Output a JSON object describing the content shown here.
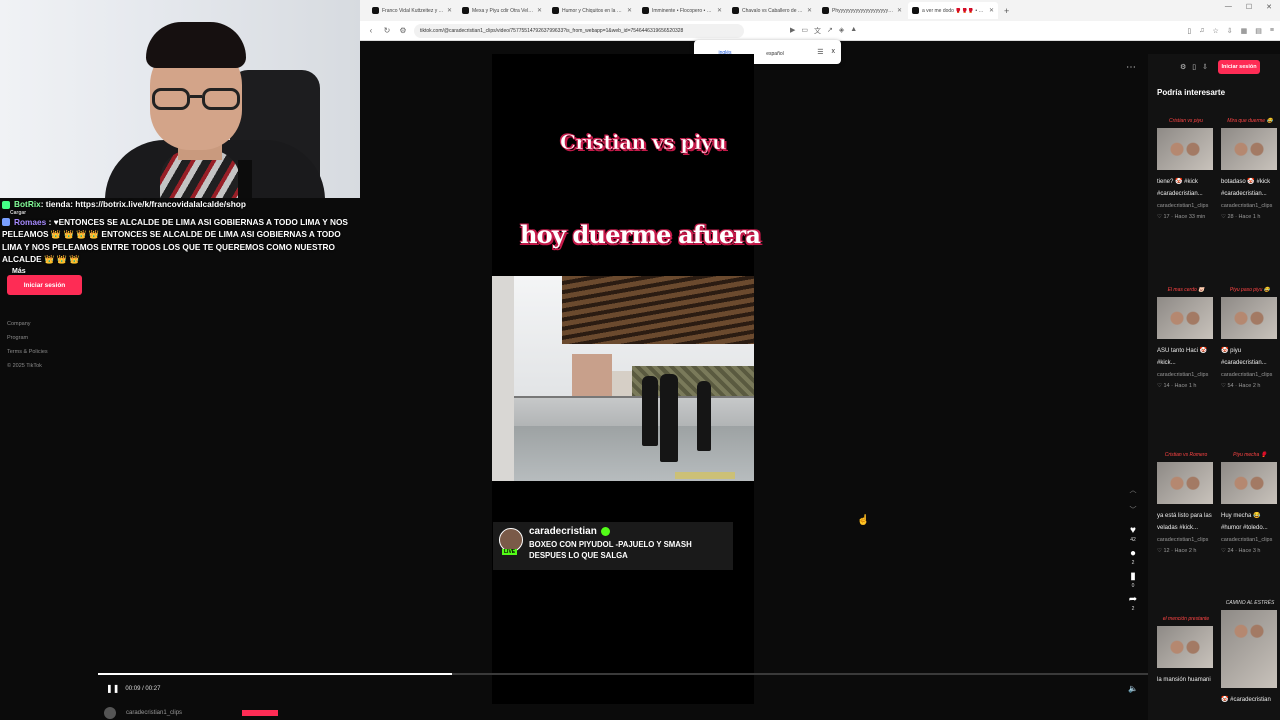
{
  "browser": {
    "tabs": [
      {
        "title": "Franco Vidal Kuttzeitez y Alcalde en..."
      },
      {
        "title": "Mexa y Piyu cdir Otra Velada Fracaso"
      },
      {
        "title": "Humor y Chiquitos en la Velada de..."
      },
      {
        "title": "Imminente • Flocopero • Plocanig"
      },
      {
        "title": "Chavalo vs Caballero de Aldeiro La Ci..."
      },
      {
        "title": "Phyyyyyyyyyyyyyyyyyyyyyyyyyyy..."
      },
      {
        "title": "a ver me dodo 🥊🥊🥊 • TikTok"
      }
    ],
    "url": "tiktok.com/@caradecristian1_clips/video/7577551479263799633?is_from_webapp=1&web_id=7546446319656520328",
    "translate": {
      "lang1": "inglés",
      "lang2": "español",
      "close": "x"
    }
  },
  "chat": [
    {
      "name": "BotRix",
      "text": ": tienda: https://botrix.live/k/francovidalalcalde/shop"
    },
    {
      "name": "Romaes",
      "text": ": ♥ENTONCES SE ALCALDE DE LIMA ASI GOBIERNAS A TODO LIMA Y NOS PELEAMOS 👑 👑 👑 👑 ENTONCES SE ALCALDE DE LIMA ASI GOBIERNAS A TODO LIMA Y NOS PELEAMOS ENTRE TODOS LOS QUE TE QUEREMOS COMO NUESTRO ALCALDE 👑 👑 👑"
    },
    {
      "more": "Más",
      "extra": "Cargar"
    }
  ],
  "left": {
    "login": "Iniciar sesión",
    "links": [
      "Company",
      "Program",
      "Terms & Policies",
      "© 2025 TikTok"
    ]
  },
  "video": {
    "title_top": "Cristian vs piyu",
    "title_main": "hoy duerme afuera",
    "streamer": "caradecristian",
    "live": "LIVE",
    "desc_line1": "BOXEO CON PIYUDOL -PAJUELO Y SMASH",
    "desc_line2": "DESPUES LO QUE SALGA",
    "time": "00:09 / 00:27",
    "progress": 0.337,
    "counts": {
      "likes": "42",
      "comments": "2",
      "saves": "0",
      "shares": "2"
    },
    "bottom_author": "caradecristian1_clips"
  },
  "right": {
    "login": "Iniciar sesión",
    "heading": "Podría interesarte",
    "items": [
      {
        "cap": "Cristian vs piyu",
        "title": "tiene? 🤡 #kick #caradecristian...",
        "author": "caradecristian1_clips",
        "meta": "♡ 17 · Hace 33 min"
      },
      {
        "cap": "Mira que duerme 😂",
        "title": "botadaso 🤡 #kick #caradecristian...",
        "author": "caradecristian1_clips",
        "meta": "♡ 28 · Hace 1 h"
      },
      {
        "cap": "El mas cerdo 🐷",
        "title": "ASU tanto Haci 🤡 #kick...",
        "author": "caradecristian1_clips",
        "meta": "♡ 14 · Hace 1 h"
      },
      {
        "cap": "Piyu paso piyu 😂",
        "title": "🤡 piyu #caradecristian...",
        "author": "caradecristian1_clips",
        "meta": "♡ 54 · Hace 2 h"
      },
      {
        "cap": "Cristian vs Romero",
        "title": "ya está listo para las veladas #kick...",
        "author": "caradecristian1_clips",
        "meta": "♡ 12 · Hace 2 h"
      },
      {
        "cap": "Piyu mecha 🥊",
        "title": "Huy mecha 😂 #humor #toledo...",
        "author": "caradecristian1_clips",
        "meta": "♡ 24 · Hace 3 h"
      },
      {
        "cap": "el mención prestante",
        "title": "la mansión huamani",
        "author": "",
        "meta": ""
      },
      {
        "cap": "CAMINO AL ESTRÉS",
        "title": "🤡 #caradecristian",
        "author": "",
        "meta": ""
      }
    ]
  }
}
